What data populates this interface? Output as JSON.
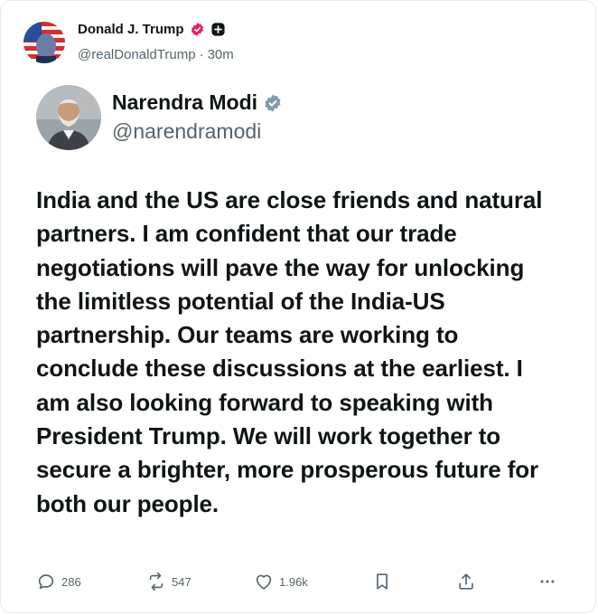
{
  "outer_post": {
    "author_name": "Donald J. Trump",
    "handle": "@realDonaldTrump",
    "separator": "·",
    "time": "30m",
    "icons": [
      "avatar-flag",
      "verified-badge-icon",
      "follow-plus-icon"
    ]
  },
  "quoted_post": {
    "author_name": "Narendra Modi",
    "handle": "@narendramodi",
    "text": "India and the US are close friends and natural partners. I am confident that our trade negotiations will pave the way for unlocking the limitless potential of the India-US partnership. Our teams are working to conclude these discussions at the earliest. I am also looking forward to speaking with President Trump. We will work together to secure a brighter, more prosperous future for both our people.",
    "icons": [
      "avatar-portrait",
      "verified-check-icon"
    ]
  },
  "actions": {
    "replies": "286",
    "reposts": "547",
    "likes": "1.96k",
    "icons": [
      "reply-icon",
      "repost-icon",
      "like-icon",
      "bookmark-icon",
      "share-icon",
      "more-icon"
    ]
  },
  "colors": {
    "text_primary": "#0f1419",
    "text_secondary": "#536471",
    "verified_pink": "#e0245e",
    "verified_gray": "#829aab"
  }
}
